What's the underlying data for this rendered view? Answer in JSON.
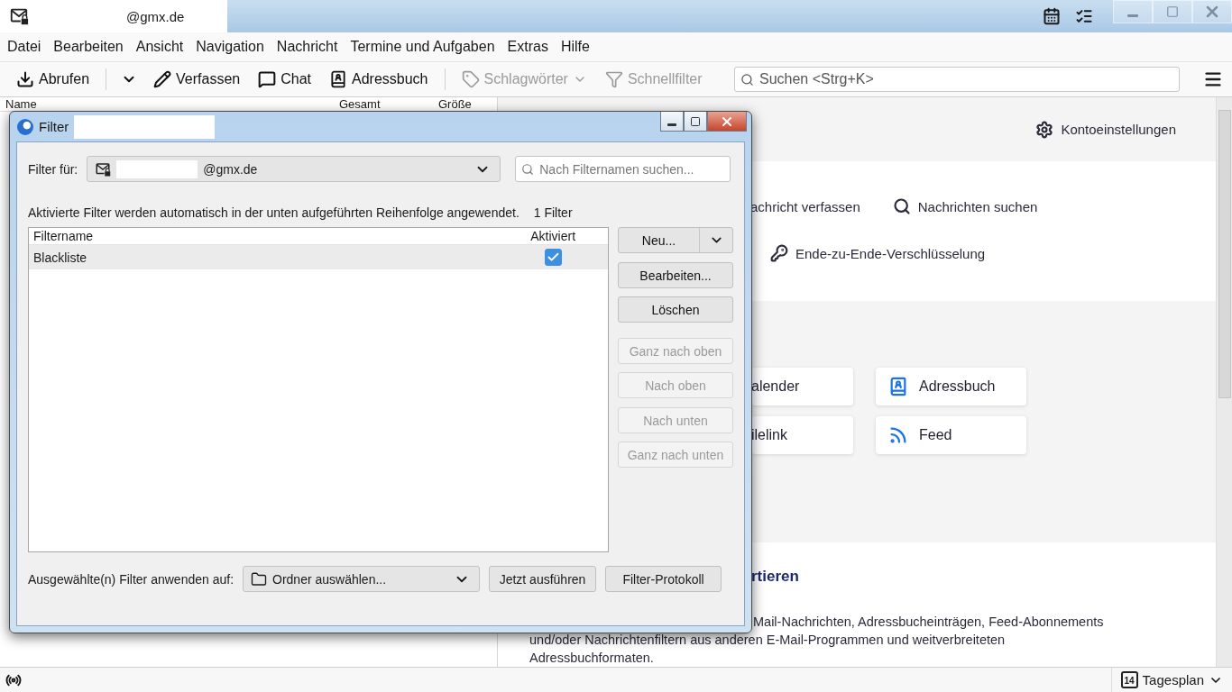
{
  "title_bar": {
    "account_tab": "@gmx.de"
  },
  "menu": [
    "Datei",
    "Bearbeiten",
    "Ansicht",
    "Navigation",
    "Nachricht",
    "Termine und Aufgaben",
    "Extras",
    "Hilfe"
  ],
  "toolbar": {
    "items": [
      {
        "kind": "split",
        "label": "Abrufen",
        "disabled": false
      },
      {
        "kind": "plain",
        "label": "Verfassen",
        "disabled": false
      },
      {
        "kind": "plain",
        "label": "Chat",
        "disabled": false
      },
      {
        "kind": "plain",
        "label": "Adressbuch",
        "disabled": false
      },
      {
        "kind": "menu",
        "label": "Schlagwörter",
        "disabled": true
      },
      {
        "kind": "plain",
        "label": "Schnellfilter",
        "disabled": true
      }
    ],
    "search": {
      "placeholder": "Suchen <Strg+K>"
    }
  },
  "folder_pane": {
    "columns": [
      "Name",
      "Gesamt",
      "Größe"
    ]
  },
  "account_hub": {
    "settings_link": "Kontoeinstellungen",
    "action_rows": [
      [
        {
          "label": "achricht verfassen",
          "icon": false
        },
        {
          "label": "Nachrichten suchen",
          "icon": true
        }
      ],
      [
        {
          "label": "Ende-zu-Ende-Verschlüsselung",
          "icon": true
        }
      ]
    ],
    "cards": [
      {
        "label": "alender",
        "icon": false
      },
      {
        "label": "Adressbuch",
        "icon": true
      },
      {
        "label": "ilelink",
        "icon": false
      },
      {
        "label": "Feed",
        "icon": true
      }
    ],
    "import_heading": "rtieren",
    "import_lines": [
      "Mail-Nachrichten, Adressbucheinträgen, Feed-Abonnements",
      "und/oder Nachrichtenfiltern aus anderen E-Mail-Programmen und weitverbreiteten",
      "Adressbuchformaten."
    ]
  },
  "dialog": {
    "title": "Filter",
    "filter_for": {
      "label": "Filter für:",
      "account": "@gmx.de"
    },
    "search": {
      "placeholder": "Nach Filternamen suchen..."
    },
    "info": "Aktivierte Filter werden automatisch in der unten aufgeführten Reihenfolge angewendet.",
    "count": "1 Filter",
    "list": {
      "columns": [
        "Filtername",
        "Aktiviert"
      ],
      "rows": [
        {
          "name": "Blackliste",
          "enabled": true,
          "selected": true
        }
      ]
    },
    "side_buttons": [
      {
        "kind": "split",
        "label": "Neu...",
        "disabled": false
      },
      {
        "kind": "plain",
        "label": "Bearbeiten...",
        "disabled": false
      },
      {
        "kind": "plain",
        "label": "Löschen",
        "disabled": false
      },
      {
        "kind": "plain",
        "label": "Ganz nach oben",
        "disabled": true
      },
      {
        "kind": "plain",
        "label": "Nach oben",
        "disabled": true
      },
      {
        "kind": "plain",
        "label": "Nach unten",
        "disabled": true
      },
      {
        "kind": "plain",
        "label": "Ganz nach unten",
        "disabled": true
      }
    ],
    "apply": {
      "label": "Ausgewählte(n) Filter anwenden auf:",
      "folder": "Ordner auswählen...",
      "run_button": "Jetzt ausführen",
      "log_button": "Filter-Protokoll"
    }
  },
  "status_bar": {
    "calendar_day": "14",
    "today_pane": "Tagesplan"
  }
}
